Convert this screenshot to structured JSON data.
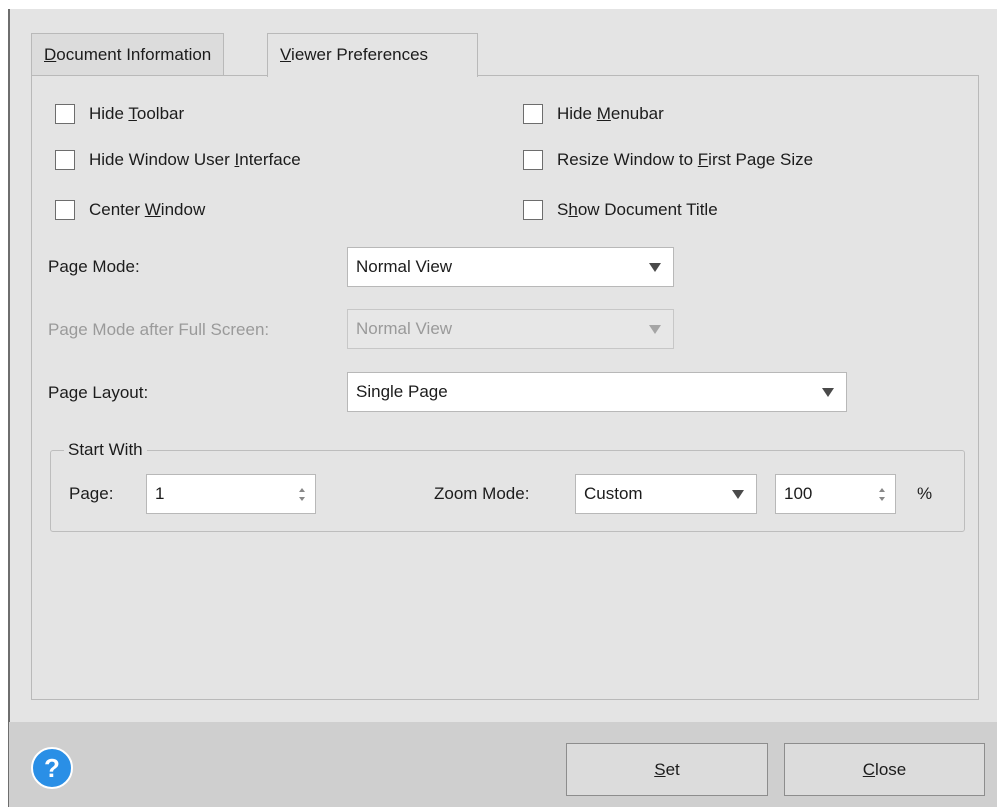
{
  "tabs": [
    {
      "label_pre": "",
      "label_u": "D",
      "label_post": "ocument Information"
    },
    {
      "label_pre": "",
      "label_u": "V",
      "label_post": "iewer Preferences"
    }
  ],
  "checkboxes": {
    "hide_toolbar": {
      "pre": "Hide ",
      "u": "T",
      "post": "oolbar"
    },
    "hide_menubar": {
      "pre": "Hide ",
      "u": "M",
      "post": "enubar"
    },
    "hide_window_ui": {
      "pre": "Hide Window User ",
      "u": "I",
      "post": "nterface"
    },
    "resize_window": {
      "pre": "Resize Window to ",
      "u": "F",
      "post": "irst Page Size"
    },
    "center_window": {
      "pre": "Center ",
      "u": "W",
      "post": "indow"
    },
    "show_doc_title": {
      "pre": "S",
      "u": "h",
      "post": "ow Document Title"
    }
  },
  "page_mode": {
    "label": "Page Mode:",
    "value": "Normal View"
  },
  "page_mode_fullscreen": {
    "label": "Page Mode after Full Screen:",
    "value": "Normal View"
  },
  "page_layout": {
    "label": "Page Layout:",
    "value": "Single Page"
  },
  "start_with": {
    "title": "Start With",
    "page_label": "Page:",
    "page_value": "1",
    "zoom_label": "Zoom Mode:",
    "zoom_mode": "Custom",
    "zoom_value": "100",
    "zoom_unit": "%"
  },
  "footer": {
    "help_glyph": "?",
    "set_pre": "",
    "set_u": "S",
    "set_post": "et",
    "close_pre": "",
    "close_u": "C",
    "close_post": "lose"
  },
  "colors": {
    "accent": "#2a8fe6",
    "background": "#e4e4e4",
    "footer": "#cfcfcf"
  }
}
